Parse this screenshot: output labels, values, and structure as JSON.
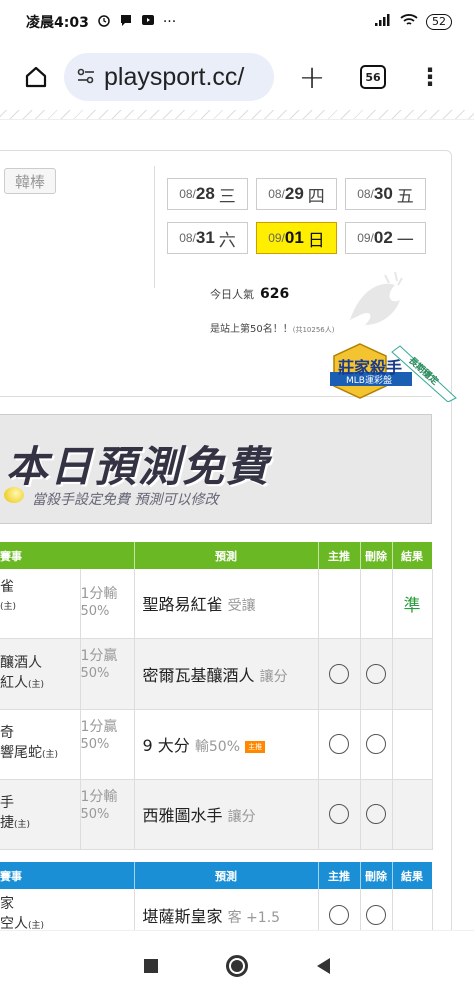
{
  "status_bar": {
    "time": "凌晨4:03",
    "more": "···",
    "battery": "52"
  },
  "browser": {
    "url": "playsport.cc/",
    "tab_count": "56",
    "plus": "+",
    "menu": "⋮"
  },
  "page": {
    "sport_tab": "韓棒",
    "dates": [
      [
        {
          "md": "08/",
          "d": "28",
          "wd": "三"
        },
        {
          "md": "08/",
          "d": "29",
          "wd": "四"
        },
        {
          "md": "08/",
          "d": "30",
          "wd": "五"
        }
      ],
      [
        {
          "md": "08/",
          "d": "31",
          "wd": "六"
        },
        {
          "md": "09/",
          "d": "01",
          "wd": "日",
          "active": true
        },
        {
          "md": "09/",
          "d": "02",
          "wd": "一"
        }
      ]
    ],
    "popularity_label": "今日人氣",
    "popularity_value": "626",
    "rank_text": "是站上第50名！！",
    "rank_total": "(共10256人)",
    "badge_main": "莊家殺手",
    "badge_sub": "MLB運彩盤",
    "badge_ribbon": "長期穩定",
    "banner_title": "本日預測免費",
    "banner_sub": "當殺手設定免費 預測可以修改"
  },
  "table1": {
    "headers": [
      "賽事",
      "預測",
      "主推",
      "刪除",
      "結果"
    ],
    "rows": [
      {
        "team_top": "雀",
        "team_bottom": "",
        "home_mark": "(主)",
        "home_on": "top",
        "odds_line1": "1分輸",
        "odds_line2": "50%",
        "prediction": "聖路易紅雀",
        "pred_sub": "受讓",
        "tag": "",
        "circles": false,
        "result": "準"
      },
      {
        "team_top": "釀酒人",
        "team_bottom": "紅人",
        "home_mark": "(主)",
        "home_on": "bottom",
        "odds_line1": "1分贏",
        "odds_line2": "50%",
        "prediction": "密爾瓦基釀酒人",
        "pred_sub": "讓分",
        "tag": "",
        "circles": true,
        "result": ""
      },
      {
        "team_top": "奇",
        "team_bottom": "響尾蛇",
        "home_mark": "(主)",
        "home_on": "bottom",
        "odds_line1": "1分贏",
        "odds_line2": "50%",
        "prediction": "9 大分",
        "pred_sub": "輸50%",
        "tag": "主推",
        "circles": true,
        "result": ""
      },
      {
        "team_top": "手",
        "team_bottom": "捷",
        "home_mark": "(主)",
        "home_on": "bottom",
        "odds_line1": "1分輸",
        "odds_line2": "50%",
        "prediction": "西雅圖水手",
        "pred_sub": "讓分",
        "tag": "",
        "circles": true,
        "result": ""
      }
    ]
  },
  "table2": {
    "headers": [
      "賽事",
      "預測",
      "主推",
      "刪除",
      "結果"
    ],
    "rows": [
      {
        "team_top": "家",
        "team_bottom": "空人",
        "home_mark": "(主)",
        "prediction": "堪薩斯皇家",
        "pred_sub": "客 +1.5"
      }
    ]
  },
  "colors": {
    "green_header": "#6ab823",
    "blue_header": "#1b8fd6",
    "active_date": "#ffee00",
    "result_green": "#2a9c3a"
  }
}
